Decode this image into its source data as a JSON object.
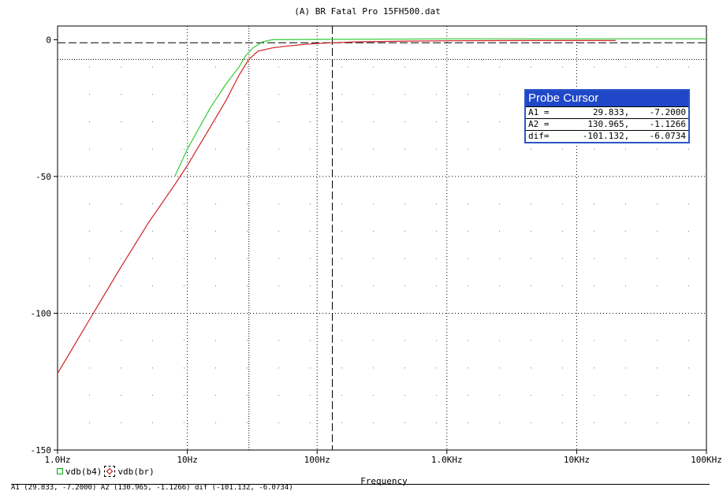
{
  "window_title": "(A) BR Fatal Pro 15FH500.dat",
  "chart_data": {
    "type": "line",
    "x_scale": "log",
    "x_range_hz": [
      1,
      100000
    ],
    "ylim": [
      -150,
      5
    ],
    "xlabel": "Frequency",
    "x_tick_values": [
      1,
      10,
      100,
      1000,
      10000,
      100000
    ],
    "x_tick_labels": [
      "1.0Hz",
      "10Hz",
      "100Hz",
      "1.0KHz",
      "10KHz",
      "100KHz"
    ],
    "y_tick_values": [
      0,
      -50,
      -100,
      -150
    ],
    "y_tick_labels": [
      "0",
      "-50",
      "-100",
      "-150"
    ],
    "grid": "dotted",
    "series": [
      {
        "name": "vdb(b4)",
        "color": "#33cc33",
        "marker": "square",
        "points": [
          [
            8,
            -50
          ],
          [
            10,
            -40
          ],
          [
            15,
            -25
          ],
          [
            20,
            -16
          ],
          [
            25,
            -10
          ],
          [
            28,
            -6
          ],
          [
            32,
            -3
          ],
          [
            38,
            -0.8
          ],
          [
            45,
            0
          ],
          [
            100,
            0.1
          ],
          [
            1000,
            0.3
          ],
          [
            10000,
            0.3
          ],
          [
            100000,
            0.3
          ]
        ]
      },
      {
        "name": "vdb(br)",
        "color": "#cc2222",
        "marker": "diamond",
        "points": [
          [
            1,
            -122
          ],
          [
            2,
            -98
          ],
          [
            3,
            -84
          ],
          [
            5,
            -67
          ],
          [
            8,
            -53
          ],
          [
            10,
            -46
          ],
          [
            15,
            -32
          ],
          [
            20,
            -22
          ],
          [
            25,
            -13
          ],
          [
            29.833,
            -7.2
          ],
          [
            35,
            -4.2
          ],
          [
            45,
            -3
          ],
          [
            60,
            -2.3
          ],
          [
            80,
            -1.7
          ],
          [
            100,
            -1.4
          ],
          [
            130.965,
            -1.1266
          ],
          [
            200,
            -0.8
          ],
          [
            500,
            -0.5
          ],
          [
            1000,
            -0.4
          ],
          [
            5000,
            -0.3
          ],
          [
            20000,
            -0.3
          ]
        ]
      }
    ],
    "cursors": [
      {
        "name": "A1",
        "x": 29.833,
        "y": -7.2
      },
      {
        "name": "A2",
        "x": 130.965,
        "y": -1.1266
      }
    ],
    "reference_level_db": -1.1266
  },
  "probe_cursor": {
    "title": "Probe Cursor",
    "rows": [
      {
        "label": "A1 =",
        "x": "29.833,",
        "y": "-7.2000"
      },
      {
        "label": "A2 =",
        "x": "130.965,",
        "y": "-1.1266"
      },
      {
        "label": "dif=",
        "x": "-101.132,",
        "y": "-6.0734"
      }
    ]
  },
  "legend": {
    "items": [
      "vdb(b4)",
      "vdb(br)"
    ]
  },
  "status_text": "A1 (29.833, -7.2000)  A2 (130.965, -1.1266)  dif (-101.132, -6.0734)"
}
